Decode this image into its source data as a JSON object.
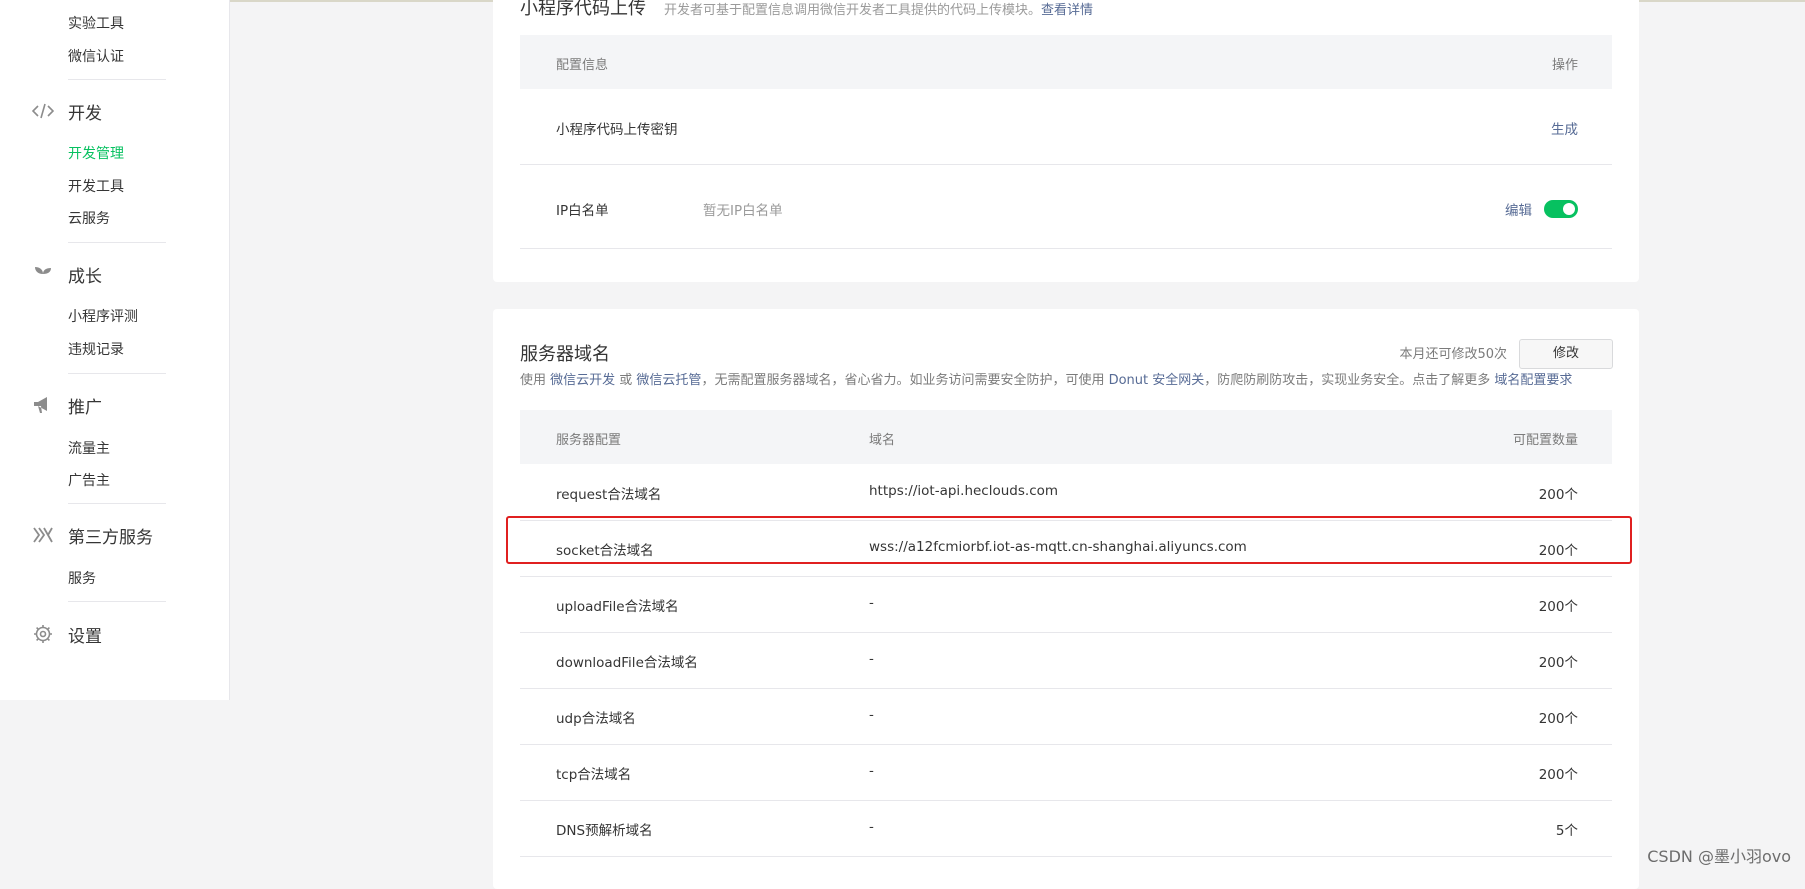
{
  "sidebar": {
    "items_top": [
      "实验工具",
      "微信认证"
    ],
    "groups": [
      {
        "icon": "code-icon",
        "label": "开发",
        "items": [
          "开发管理",
          "开发工具",
          "云服务"
        ]
      },
      {
        "icon": "sprout-icon",
        "label": "成长",
        "items": [
          "小程序评测",
          "违规记录"
        ]
      },
      {
        "icon": "megaphone-icon",
        "label": "推广",
        "items": [
          "流量主",
          "广告主"
        ]
      },
      {
        "icon": "third-party-icon",
        "label": "第三方服务",
        "items": [
          "服务"
        ]
      },
      {
        "icon": "gear-icon",
        "label": "设置",
        "items": []
      }
    ],
    "active_item": "开发管理"
  },
  "upload_card": {
    "title": "小程序代码上传",
    "desc_prefix": "开发者可基于配置信息调用微信开发者工具提供的代码上传模块。",
    "desc_link": "查看详情",
    "header": {
      "col1": "配置信息",
      "col_action": "操作"
    },
    "rows": [
      {
        "name": "小程序代码上传密钥",
        "value": "",
        "action": "生成"
      },
      {
        "name": "IP白名单",
        "value": "暂无IP白名单",
        "action": "编辑",
        "toggle_on": true
      }
    ]
  },
  "server_card": {
    "title": "服务器域名",
    "quota_text": "本月还可修改50次",
    "modify_label": "修改",
    "desc": {
      "p1": "使用 ",
      "l1": "微信云开发",
      "p2": " 或 ",
      "l2": "微信云托管",
      "p3": "，无需配置服务器域名，省心省力。如业务访问需要安全防护，可使用 ",
      "l3": "Donut 安全网关",
      "p4": "，防爬防刷防攻击，实现业务安全。点击了解更多 ",
      "l4": "域名配置要求"
    },
    "header": {
      "col1": "服务器配置",
      "col2": "域名",
      "col3": "可配置数量"
    },
    "rows": [
      {
        "name": "request合法域名",
        "domain": "https://iot-api.heclouds.com",
        "count": "200个"
      },
      {
        "name": "socket合法域名",
        "domain": "wss://a12fcmiorbf.iot-as-mqtt.cn-shanghai.aliyuncs.com",
        "count": "200个"
      },
      {
        "name": "uploadFile合法域名",
        "domain": "-",
        "count": "200个"
      },
      {
        "name": "downloadFile合法域名",
        "domain": "-",
        "count": "200个"
      },
      {
        "name": "udp合法域名",
        "domain": "-",
        "count": "200个"
      },
      {
        "name": "tcp合法域名",
        "domain": "-",
        "count": "200个"
      },
      {
        "name": "DNS预解析域名",
        "domain": "-",
        "count": "5个"
      }
    ]
  },
  "watermark": "CSDN @墨小羽ovo",
  "colors": {
    "accent": "#07c160",
    "link": "#576b95",
    "highlight": "#e02020"
  }
}
